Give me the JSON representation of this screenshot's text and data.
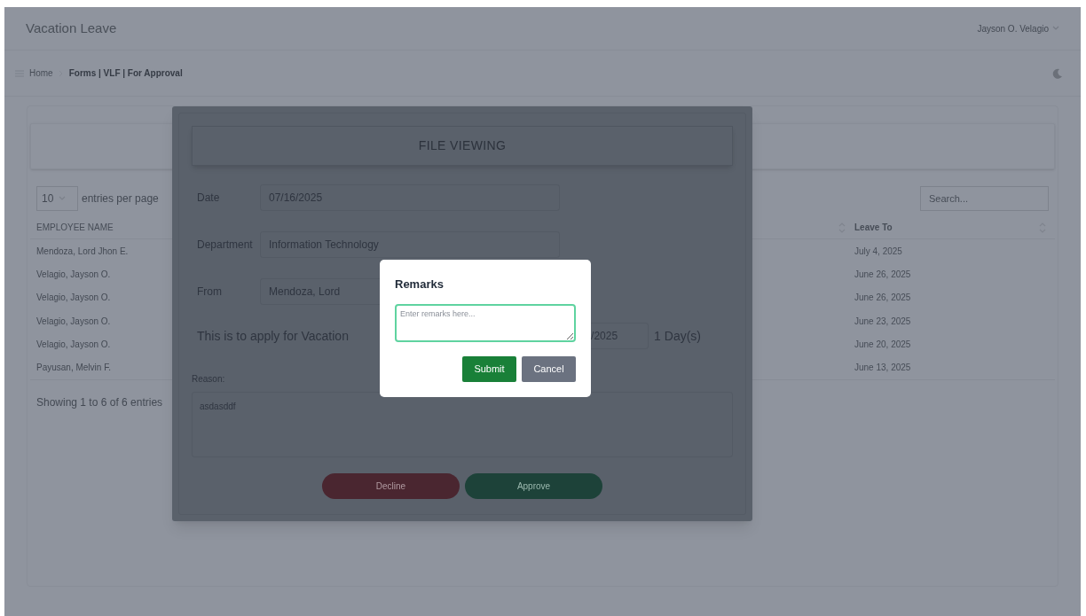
{
  "header": {
    "title": "Vacation Leave",
    "user": "Jayson O. Velagio"
  },
  "breadcrumb": [
    {
      "label": "Home",
      "current": false
    },
    {
      "label": "Forms | VLF | For Approval",
      "current": true
    }
  ],
  "table": {
    "page_size": "10",
    "page_size_label": "entries per page",
    "search": {
      "placeholder": "Search..."
    },
    "columns": [
      {
        "label": "EMPLOYEE NAME"
      },
      {
        "label": "Leave To"
      }
    ],
    "rows": [
      {
        "employee_name": "Mendoza, Lord Jhon E.",
        "leave_to": "July 4, 2025"
      },
      {
        "employee_name": "Velagio, Jayson O.",
        "leave_to": "June 26, 2025"
      },
      {
        "employee_name": "Velagio, Jayson O.",
        "leave_to": "June 26, 2025"
      },
      {
        "employee_name": "Velagio, Jayson O.",
        "leave_to": "June 23, 2025"
      },
      {
        "employee_name": "Velagio, Jayson O.",
        "leave_to": "June 20, 2025"
      },
      {
        "employee_name": "Payusan, Melvin F.",
        "leave_to": "June 13, 2025"
      }
    ],
    "footer": "Showing 1 to 6 of 6 entries"
  },
  "file_viewing": {
    "title": "FILE VIEWING",
    "fields": [
      {
        "label": "Date",
        "value": "07/16/2025"
      },
      {
        "label": "Department",
        "value": "Information Technology"
      },
      {
        "label": "From",
        "value": "Mendoza, Lord"
      }
    ],
    "application_text": "This is to apply for Vacation",
    "date_value": "/2025",
    "days": "1 Day(s)",
    "reason_label": "Reason:",
    "reason": "asdasddf",
    "buttons": [
      {
        "label": "Decline",
        "kind": "decline"
      },
      {
        "label": "Approve",
        "kind": "approve"
      }
    ]
  },
  "remarks_dialog": {
    "title": "Remarks",
    "placeholder": "Enter remarks here...",
    "buttons": [
      {
        "label": "Submit",
        "kind": "primary"
      },
      {
        "label": "Cancel",
        "kind": "secondary"
      }
    ]
  }
}
